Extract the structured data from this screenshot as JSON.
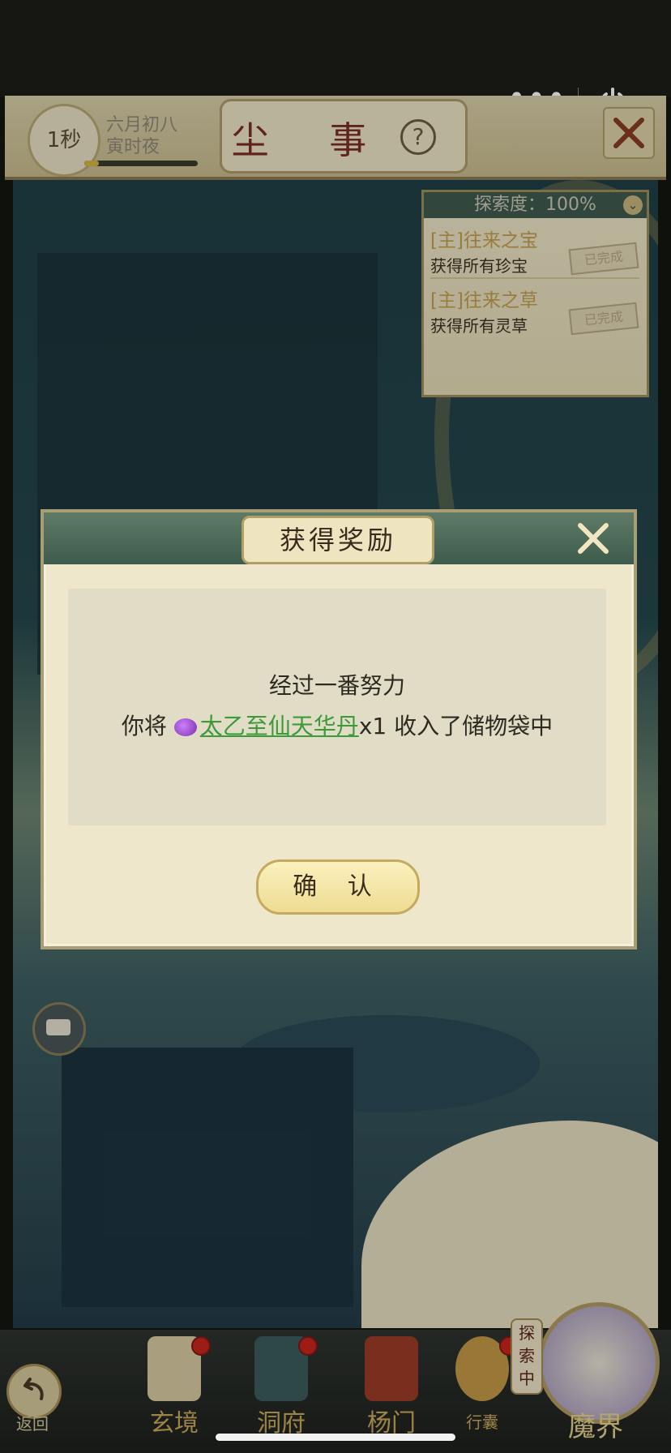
{
  "header": {
    "time": "1秒",
    "date_line1": "六月初八",
    "date_line2": "寅时夜",
    "title": "尘 事",
    "help_symbol": "?"
  },
  "mini_program": {
    "more_symbol": "•••"
  },
  "explore_panel": {
    "label": "探索度：100%",
    "tasks": [
      {
        "title": "[主]往来之宝",
        "desc": "获得所有珍宝",
        "status": "已完成"
      },
      {
        "title": "[主]往来之草",
        "desc": "获得所有灵草",
        "status": "已完成"
      }
    ]
  },
  "modal": {
    "title": "获得奖励",
    "line1": "经过一番努力",
    "line2_prefix": "你将",
    "item_name": "太乙至仙天华丹",
    "line2_suffix": "x1 收入了储物袋中",
    "confirm_label": "确 认"
  },
  "bottom_nav": {
    "back_label": "返回",
    "items": [
      "玄境",
      "洞府",
      "杨门",
      "行囊"
    ],
    "realm_tag": "探索中",
    "realm_label": "魔界"
  },
  "colors": {
    "accent_gold": "#caa85a",
    "item_link": "#3d9a3a",
    "title_red": "#7b2f26"
  }
}
